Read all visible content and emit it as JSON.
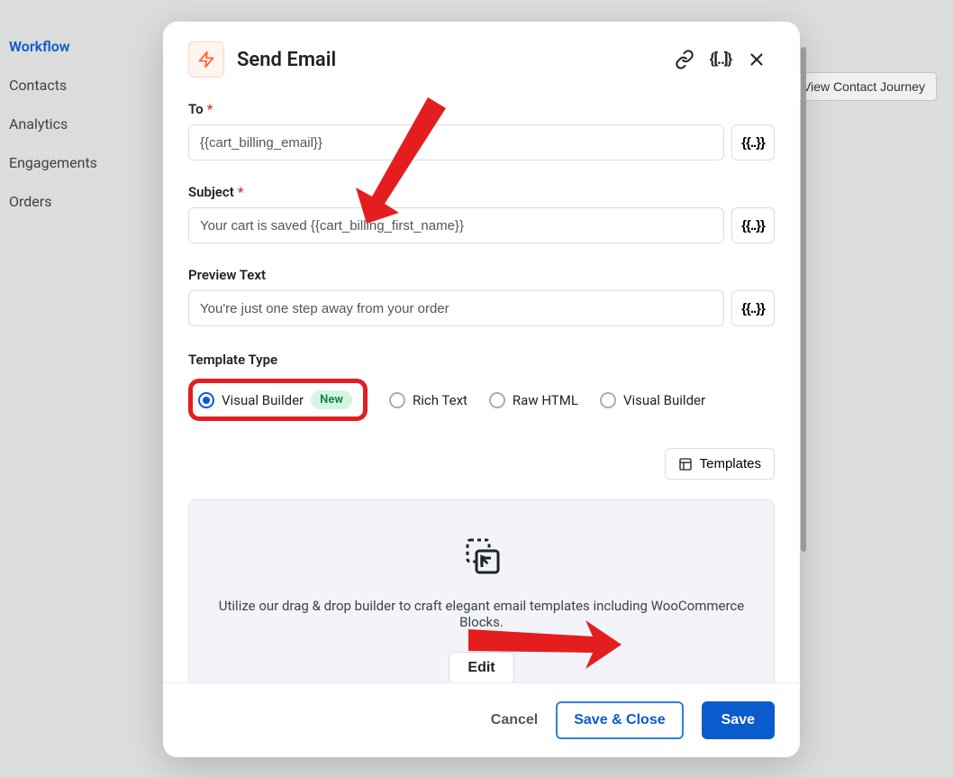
{
  "sidebar": {
    "items": [
      {
        "label": "Workflow",
        "active": true
      },
      {
        "label": "Contacts"
      },
      {
        "label": "Analytics"
      },
      {
        "label": "Engagements"
      },
      {
        "label": "Orders"
      }
    ]
  },
  "external": {
    "view_journey": "View Contact Journey"
  },
  "modal": {
    "title": "Send Email",
    "fields": {
      "to_label": "To",
      "to_value": "{{cart_billing_email}}",
      "subject_label": "Subject",
      "subject_value": "Your cart is saved {{cart_billing_first_name}}",
      "preview_label": "Preview Text",
      "preview_value": "You're just one step away from your order"
    },
    "template": {
      "label": "Template Type",
      "options": {
        "vb_new": "Visual Builder",
        "badge": "New",
        "rich": "Rich Text",
        "raw": "Raw HTML",
        "vb": "Visual Builder"
      },
      "templates_btn": "Templates",
      "builder_desc": "Utilize our drag & drop builder to craft elegant email templates including WooCommerce Blocks.",
      "edit": "Edit"
    },
    "footer": {
      "cancel": "Cancel",
      "save_close": "Save & Close",
      "save": "Save"
    }
  }
}
